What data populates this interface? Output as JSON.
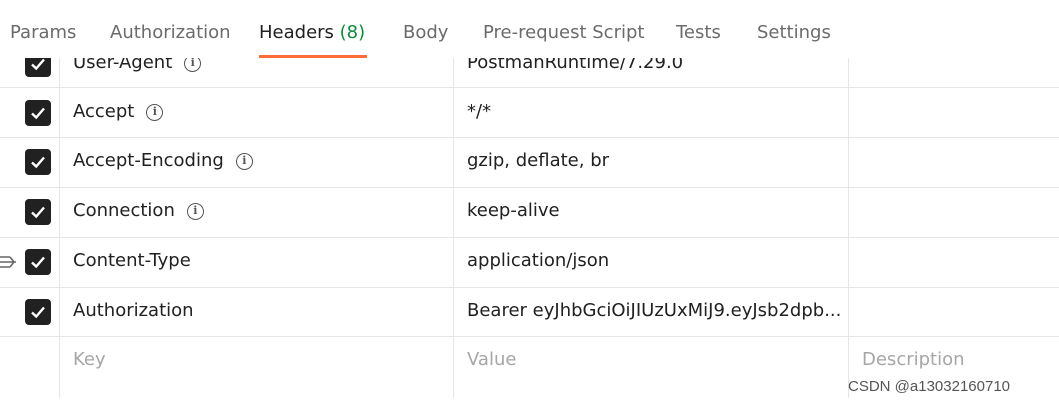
{
  "tabs": [
    {
      "label": "Params",
      "active": false
    },
    {
      "label": "Authorization",
      "active": false
    },
    {
      "label": "Headers",
      "count": "(8)",
      "active": true
    },
    {
      "label": "Body",
      "active": false
    },
    {
      "label": "Pre-request Script",
      "active": false
    },
    {
      "label": "Tests",
      "active": false
    },
    {
      "label": "Settings",
      "active": false
    }
  ],
  "headers": [
    {
      "key": "User-Agent",
      "value": "PostmanRuntime/7.29.0",
      "checked": true,
      "info": true
    },
    {
      "key": "Accept",
      "value": "*/*",
      "checked": true,
      "info": true
    },
    {
      "key": "Accept-Encoding",
      "value": "gzip, deflate, br",
      "checked": true,
      "info": true
    },
    {
      "key": "Connection",
      "value": "keep-alive",
      "checked": true,
      "info": true
    },
    {
      "key": "Content-Type",
      "value": "application/json",
      "checked": true,
      "info": false
    },
    {
      "key": "Authorization",
      "value": "Bearer eyJhbGciOiJIUzUxMiJ9.eyJsb2dpb...",
      "checked": true,
      "info": false
    }
  ],
  "new_row": {
    "key_placeholder": "Key",
    "value_placeholder": "Value",
    "description_placeholder": "Description"
  },
  "watermark": "CSDN @a13032160710",
  "colors": {
    "accent": "#ff6c37",
    "count": "#0f8a3a",
    "checkbox": "#212121"
  }
}
